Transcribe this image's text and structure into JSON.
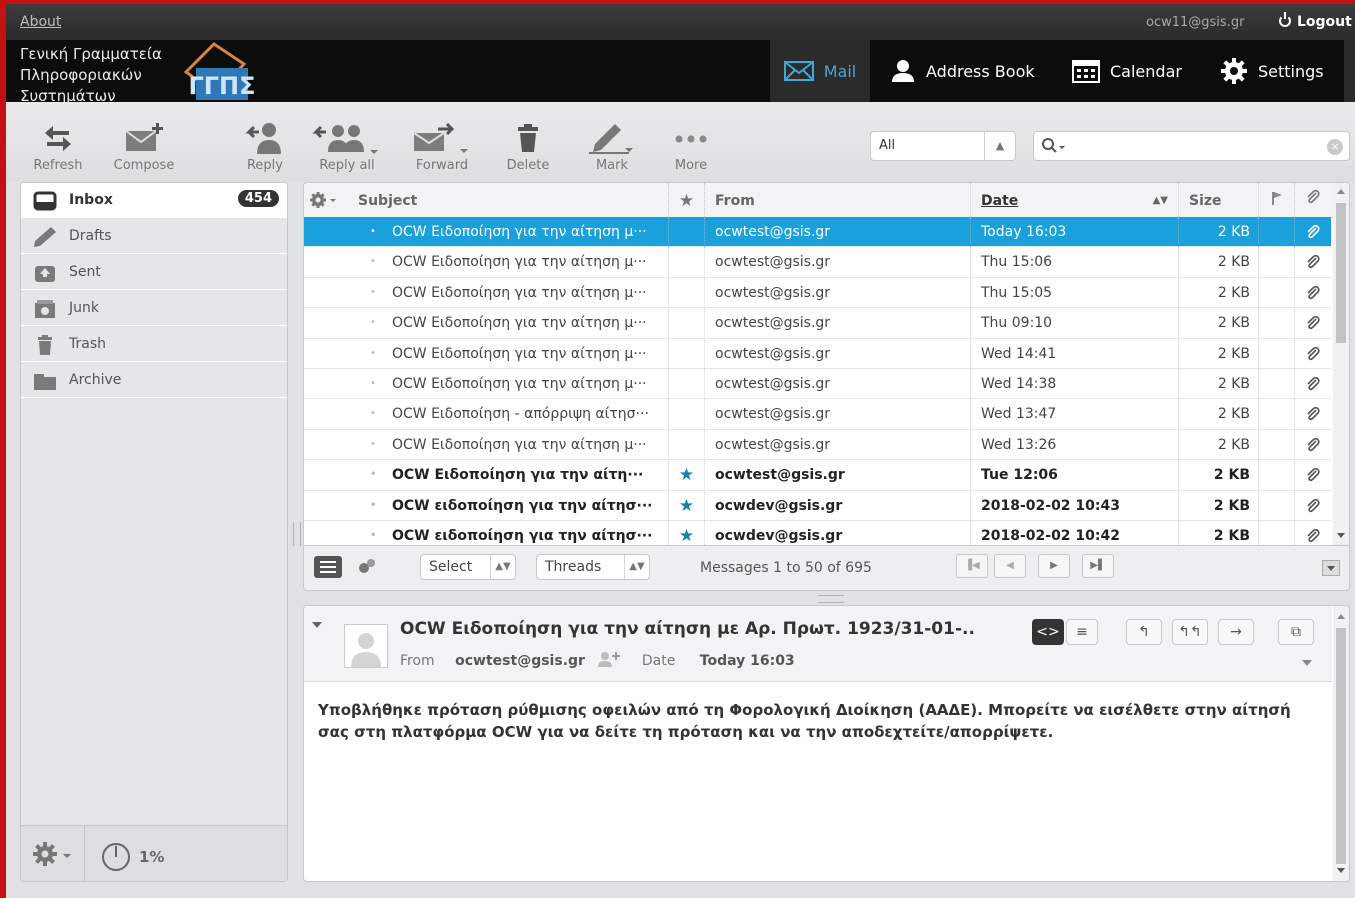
{
  "topbar": {
    "about": "About",
    "user_email": "ocw11@gsis.gr",
    "logout": "Logout"
  },
  "header": {
    "logo_lines": [
      "Γενική Γραμματεία",
      "Πληροφοριακών",
      "Συστημάτων"
    ],
    "logo_mark": "ΓΓΠΣ",
    "nav": {
      "mail": "Mail",
      "address_book": "Address Book",
      "calendar": "Calendar",
      "settings": "Settings"
    },
    "accent": "#3fa7d9"
  },
  "toolbar": {
    "refresh": "Refresh",
    "compose": "Compose",
    "reply": "Reply",
    "reply_all": "Reply all",
    "forward": "Forward",
    "delete": "Delete",
    "mark": "Mark",
    "more": "More",
    "filter_value": "All",
    "search_value": ""
  },
  "folders": [
    {
      "label": "Inbox",
      "icon": "inbox-icon",
      "count": "454"
    },
    {
      "label": "Drafts",
      "icon": "pencil-icon"
    },
    {
      "label": "Sent",
      "icon": "sent-icon"
    },
    {
      "label": "Junk",
      "icon": "junk-icon"
    },
    {
      "label": "Trash",
      "icon": "trash-icon"
    },
    {
      "label": "Archive",
      "icon": "archive-icon"
    }
  ],
  "quota": "1%",
  "list": {
    "headers": {
      "subject": "Subject",
      "from": "From",
      "date": "Date",
      "size": "Size"
    },
    "rows": [
      {
        "subject": "OCW Ειδοποίηση για την αίτηση μ···",
        "from": "ocwtest@gsis.gr",
        "date": "Today 16:03",
        "size": "2 KB",
        "flagged": false,
        "unread": false,
        "selected": true
      },
      {
        "subject": "OCW Ειδοποίηση για την αίτηση μ···",
        "from": "ocwtest@gsis.gr",
        "date": "Thu 15:06",
        "size": "2 KB",
        "flagged": false,
        "unread": false
      },
      {
        "subject": "OCW Ειδοποίηση για την αίτηση μ···",
        "from": "ocwtest@gsis.gr",
        "date": "Thu 15:05",
        "size": "2 KB",
        "flagged": false,
        "unread": false
      },
      {
        "subject": "OCW Ειδοποίηση για την αίτηση μ···",
        "from": "ocwtest@gsis.gr",
        "date": "Thu 09:10",
        "size": "2 KB",
        "flagged": false,
        "unread": false
      },
      {
        "subject": "OCW Ειδοποίηση για την αίτηση μ···",
        "from": "ocwtest@gsis.gr",
        "date": "Wed 14:41",
        "size": "2 KB",
        "flagged": false,
        "unread": false
      },
      {
        "subject": "OCW Ειδοποίηση για την αίτηση μ···",
        "from": "ocwtest@gsis.gr",
        "date": "Wed 14:38",
        "size": "2 KB",
        "flagged": false,
        "unread": false
      },
      {
        "subject": "OCW Ειδοποίηση - απόρριψη αίτησ···",
        "from": "ocwtest@gsis.gr",
        "date": "Wed 13:47",
        "size": "2 KB",
        "flagged": false,
        "unread": false
      },
      {
        "subject": "OCW Ειδοποίηση για την αίτηση μ···",
        "from": "ocwtest@gsis.gr",
        "date": "Wed 13:26",
        "size": "2 KB",
        "flagged": false,
        "unread": false
      },
      {
        "subject": "OCW Ειδοποίηση για την αίτη···",
        "from": "ocwtest@gsis.gr",
        "date": "Tue 12:06",
        "size": "2 KB",
        "flagged": true,
        "unread": true
      },
      {
        "subject": "OCW ειδοποίηση για την αίτησ···",
        "from": "ocwdev@gsis.gr",
        "date": "2018-02-02 10:43",
        "size": "2 KB",
        "flagged": true,
        "unread": true
      },
      {
        "subject": "OCW ειδοποίηση για την αίτησ···",
        "from": "ocwdev@gsis.gr",
        "date": "2018-02-02 10:42",
        "size": "2 KB",
        "flagged": true,
        "unread": true
      }
    ],
    "footer": {
      "select": "Select",
      "threads": "Threads",
      "count_text": "Messages 1 to 50 of 695"
    }
  },
  "preview": {
    "subject": "OCW Ειδοποίηση για την αίτηση με Αρ. Πρωτ. 1923/31-01-..",
    "from_label": "From",
    "from": "ocwtest@gsis.gr",
    "date_label": "Date",
    "date": "Today 16:03",
    "body": "Υποβλήθηκε πρόταση ρύθμισης οφειλών από τη Φορολογική Διοίκηση (ΑΑΔΕ). Μπορείτε να εισέλθετε στην αίτησή σας στη πλατφόρμα OCW για να δείτε τη πρόταση και να την αποδεχτείτε/απορρίψετε."
  }
}
